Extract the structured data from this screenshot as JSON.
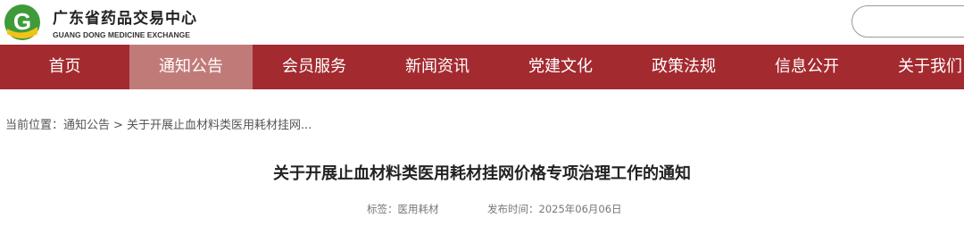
{
  "header": {
    "logo_letter": "G",
    "logo_title": "广东省药品交易中心",
    "logo_subtitle": "GUANG DONG MEDICINE EXCHANGE",
    "search_value": ""
  },
  "nav": {
    "items": [
      {
        "label": "首页"
      },
      {
        "label": "通知公告",
        "active": true
      },
      {
        "label": "会员服务"
      },
      {
        "label": "新闻资讯"
      },
      {
        "label": "党建文化"
      },
      {
        "label": "政策法规"
      },
      {
        "label": "信息公开"
      },
      {
        "label": "关于我们"
      }
    ]
  },
  "breadcrumb": {
    "prefix": "当前位置：",
    "section": "通知公告",
    "separator": ">",
    "current": "关于开展止血材料类医用耗材挂网..."
  },
  "article": {
    "title": "关于开展止血材料类医用耗材挂网价格专项治理工作的通知",
    "tag_label": "标签：",
    "tag_value": "医用耗材",
    "date_label": "发布时间：",
    "date_value": "2025年06月06日"
  },
  "colors": {
    "nav_bg": "#a32a2f",
    "nav_active_bg": "#c07b79",
    "logo_green": "#3f9b3a",
    "logo_yellow": "#f2c316"
  }
}
